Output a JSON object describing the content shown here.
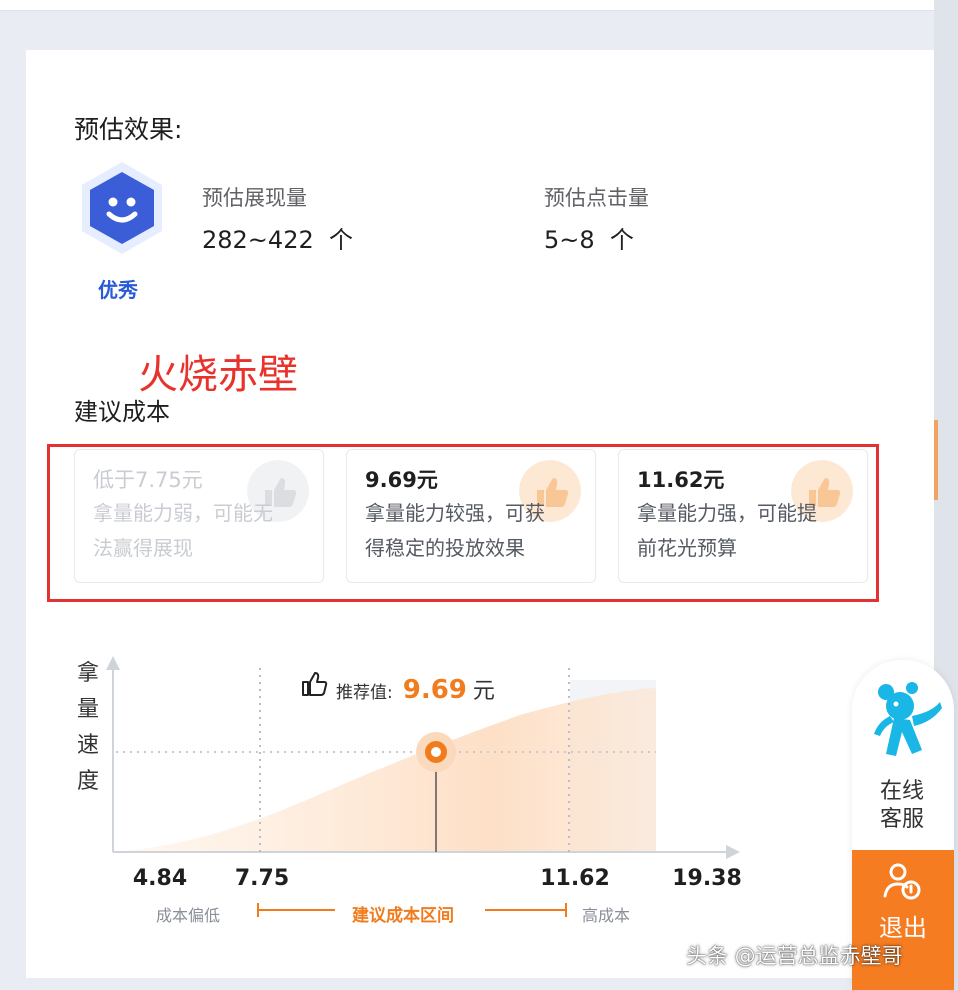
{
  "estimate": {
    "title": "预估效果:",
    "badge_label": "优秀",
    "impressions_label": "预估展现量",
    "impressions_value": "282~422",
    "impressions_unit": "个",
    "clicks_label": "预估点击量",
    "clicks_value": "5~8",
    "clicks_unit": "个"
  },
  "watermark_text": "火烧赤壁",
  "cost": {
    "title": "建议成本",
    "cards": [
      {
        "price": "低于7.75元",
        "desc_line1": "拿量能力弱，可能无",
        "desc_line2": "法赢得展现",
        "state": "disabled"
      },
      {
        "price": "9.69元",
        "desc_line1": "拿量能力较强，可获",
        "desc_line2": "得稳定的投放效果",
        "state": "enabled"
      },
      {
        "price": "11.62元",
        "desc_line1": "拿量能力强，可能提",
        "desc_line2": "前花光预算",
        "state": "enabled"
      }
    ]
  },
  "chart_data": {
    "type": "area",
    "ylabel_chars": [
      "拿",
      "量",
      "速",
      "度"
    ],
    "x_ticks": [
      "4.84",
      "7.75",
      "11.62",
      "19.38"
    ],
    "recommended": {
      "label": "推荐值:",
      "value": "9.69",
      "unit": "元"
    },
    "range_low_label": "成本偏低",
    "range_mid_label": "建议成本区间",
    "range_high_label": "高成本",
    "accent_color": "#f07c1e"
  },
  "customer_service": {
    "label_line1": "在线",
    "label_line2": "客服",
    "exit_label": "退出"
  },
  "credit": "头条 @运营总监赤壁哥"
}
